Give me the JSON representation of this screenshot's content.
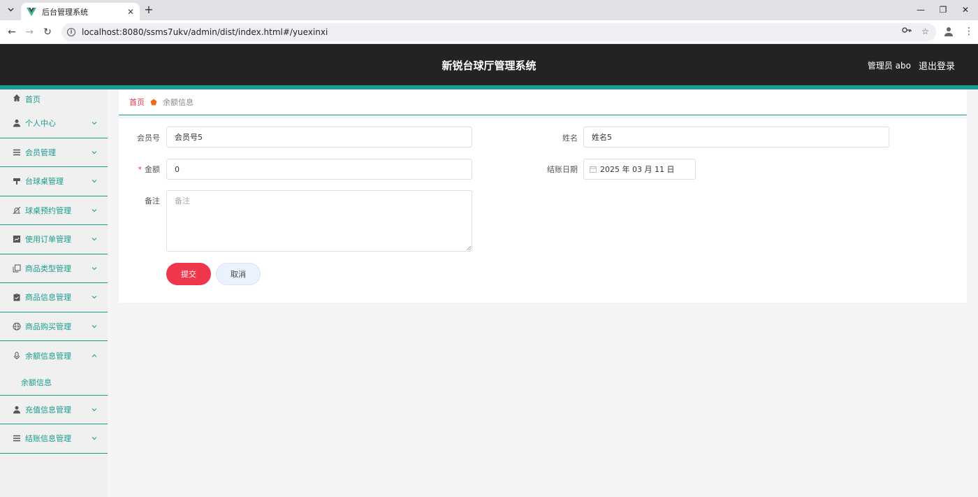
{
  "browser": {
    "tab_title": "后台管理系统",
    "url": "localhost:8080/ssms7ukv/admin/dist/index.html#/yuexinxi"
  },
  "header": {
    "title": "新锐台球厅管理系统",
    "user_label": "管理员 abo",
    "logout_label": "退出登录"
  },
  "sidebar": {
    "home": "首页",
    "items": [
      {
        "label": "个人中心",
        "icon": "user-icon"
      },
      {
        "label": "会员管理",
        "icon": "list-icon"
      },
      {
        "label": "台球桌管理",
        "icon": "table-icon"
      },
      {
        "label": "球桌预约管理",
        "icon": "bell-off-icon"
      },
      {
        "label": "使用订单管理",
        "icon": "chart-icon"
      },
      {
        "label": "商品类型管理",
        "icon": "copy-icon"
      },
      {
        "label": "商品信息管理",
        "icon": "clipboard-icon"
      },
      {
        "label": "商品购买管理",
        "icon": "globe-icon"
      },
      {
        "label": "余额信息管理",
        "icon": "microphone-icon"
      },
      {
        "label": "充值信息管理",
        "icon": "user-icon"
      },
      {
        "label": "结账信息管理",
        "icon": "list-icon"
      }
    ],
    "submenu_active": "余额信息"
  },
  "breadcrumb": {
    "home": "首页",
    "current": "余额信息"
  },
  "form": {
    "member_no_label": "会员号",
    "member_no_value": "会员号5",
    "name_label": "姓名",
    "name_value": "姓名5",
    "amount_required_mark": "*",
    "amount_label": "金额",
    "amount_value": "0",
    "checkout_date_label": "结账日期",
    "checkout_date_value": "2025 年 03 月 11 日",
    "remark_label": "备注",
    "remark_placeholder": "备注",
    "submit_label": "提交",
    "cancel_label": "取消"
  },
  "colors": {
    "accent": "#1a9c8e",
    "primary_button": "#f0364b",
    "header_bg": "#232323"
  }
}
